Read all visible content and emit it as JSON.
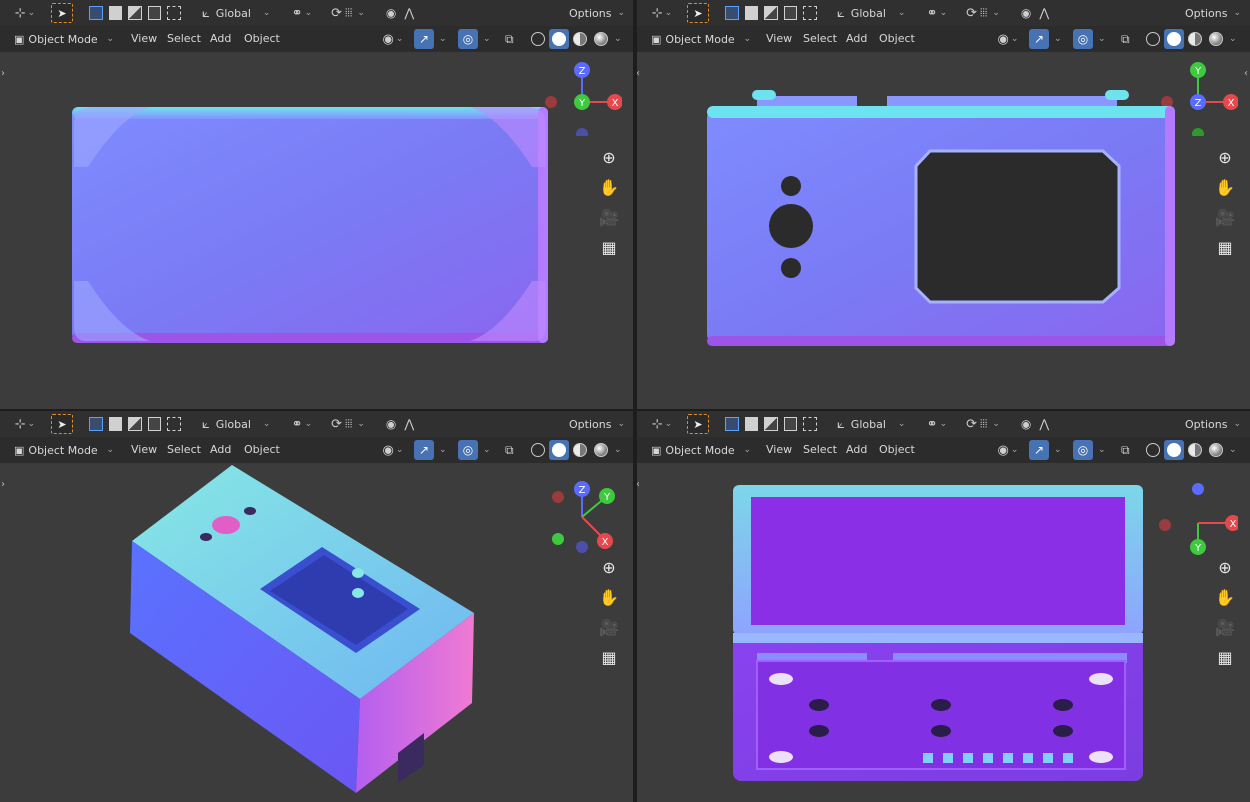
{
  "toolbar": {
    "transform_orientation": "Global",
    "options_label": "Options",
    "mode_label": "Object Mode",
    "menus": [
      "View",
      "Select",
      "Add",
      "Object"
    ]
  },
  "panes": [
    "top-left",
    "top-right",
    "bottom-left",
    "bottom-right"
  ],
  "gizmo": {
    "axis_x": "X",
    "axis_y": "Y",
    "axis_z": "Z"
  },
  "colors": {
    "x_axis": "#e5484d",
    "y_axis": "#3ec93e",
    "z_axis": "#5a6bff",
    "accent": "#4772b3",
    "tool_highlight": "#e08a2a"
  },
  "icons": {
    "side_tools": [
      "zoom-icon",
      "hand-pan-icon",
      "camera-icon",
      "grid-icon"
    ]
  }
}
